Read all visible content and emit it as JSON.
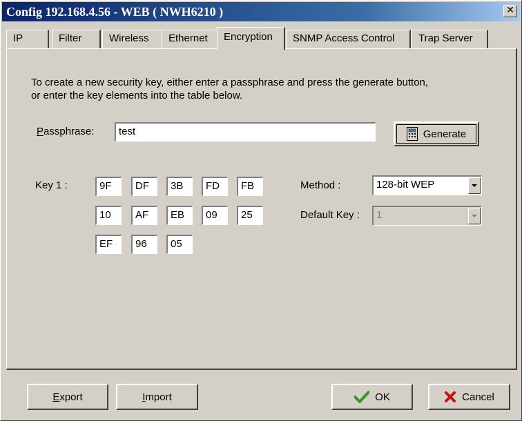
{
  "window": {
    "title": "Config 192.168.4.56 - WEB ( NWH6210 )",
    "close_glyph": "✕"
  },
  "tabs": [
    {
      "label": "IP"
    },
    {
      "label": "Filter"
    },
    {
      "label": "Wireless"
    },
    {
      "label": "Ethernet"
    },
    {
      "label": "Encryption"
    },
    {
      "label": "SNMP Access Control"
    },
    {
      "label": "Trap Server"
    }
  ],
  "active_tab": "Encryption",
  "encryption": {
    "instructions_line1": "To create a new security key, either enter a passphrase and press the generate button,",
    "instructions_line2": "or enter the key elements into the table below.",
    "passphrase_label": "Passphrase:",
    "passphrase_value": "test",
    "generate_label": "Generate",
    "key_label": "Key 1 :",
    "key_bytes": [
      "9F",
      "DF",
      "3B",
      "FD",
      "FB",
      "10",
      "AF",
      "EB",
      "09",
      "25",
      "EF",
      "96",
      "05"
    ],
    "method_label": "Method :",
    "method_value": "128-bit WEP",
    "default_key_label": "Default Key :",
    "default_key_value": "1"
  },
  "footer": {
    "export_label": "Export",
    "import_label": "Import",
    "ok_label": "OK",
    "cancel_label": "Cancel"
  },
  "colors": {
    "ok_check": "#2e9b1e",
    "cancel_x": "#cc1010",
    "titlebar_start": "#0a246a",
    "titlebar_end": "#a6caf0"
  }
}
